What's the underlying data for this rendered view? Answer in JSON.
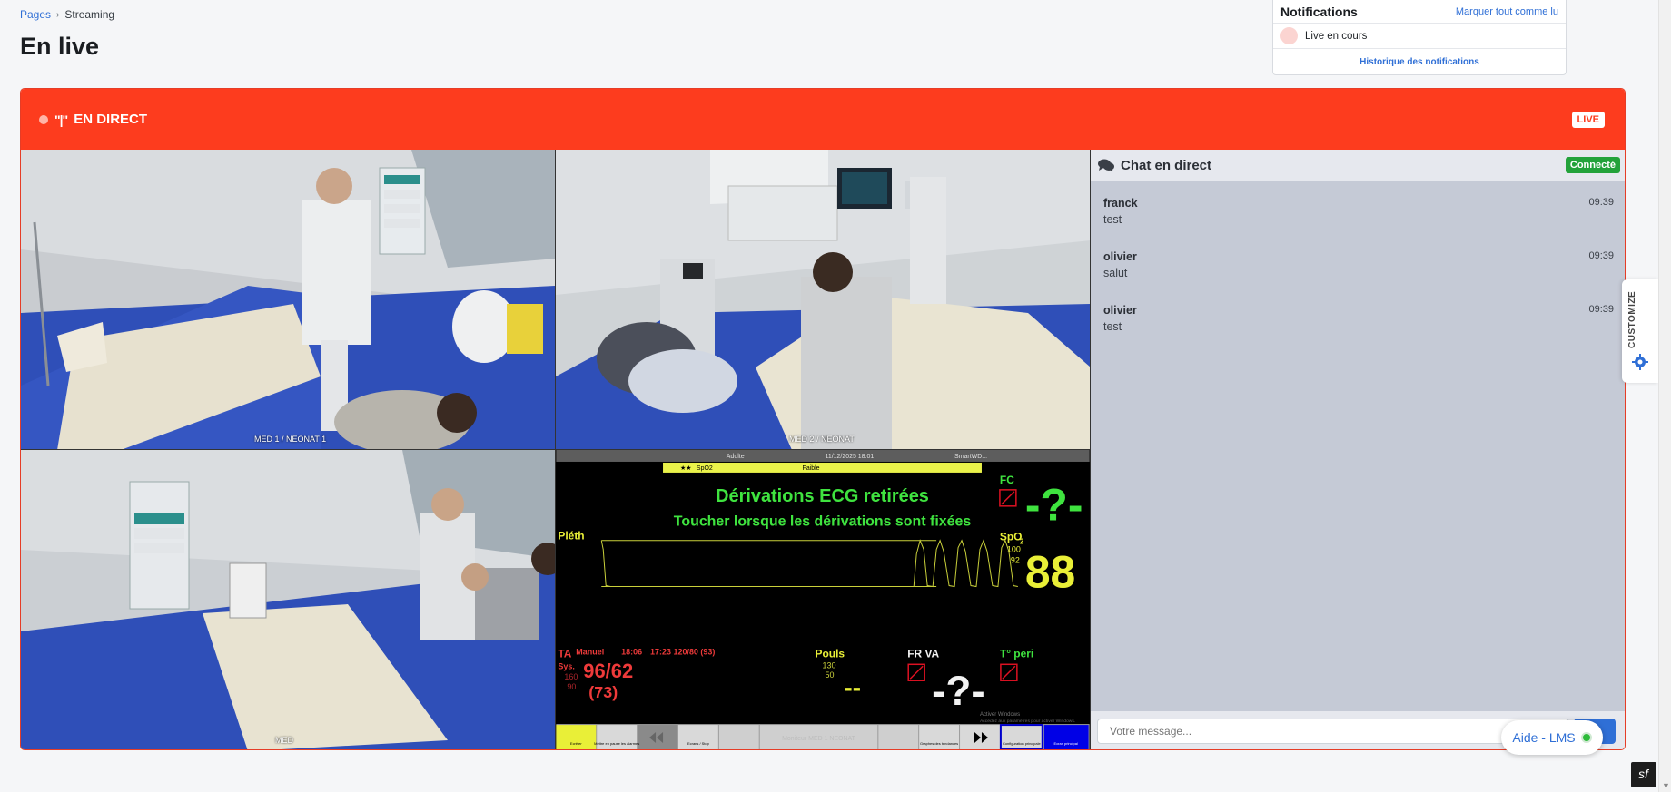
{
  "breadcrumb": {
    "parent": "Pages",
    "current": "Streaming"
  },
  "page": {
    "title": "En live"
  },
  "notifications": {
    "title": "Notifications",
    "mark_all": "Marquer tout comme lu",
    "items": [
      {
        "label": "Live en cours"
      }
    ],
    "history": "Historique des notifications"
  },
  "live": {
    "status_label": "EN DIRECT",
    "antenna": "\"|\"",
    "badge": "LIVE",
    "accent": "#fd3c1e"
  },
  "cameras": [
    {
      "label": "MED 1 / NEONAT 1"
    },
    {
      "label": "MED 2 / NEONAT"
    },
    {
      "label": "MED"
    }
  ],
  "monitor": {
    "top_bar": {
      "mode": "Adulte",
      "datetime": "11/12/2025 18:01",
      "unit": "SmartWD..."
    },
    "alarm_bar": {
      "stars": "★★",
      "param": "SpO2",
      "level": "Faible"
    },
    "ecg_msg": "Dérivations ECG retirées",
    "ecg_sub": "Toucher lorsque les dérivations sont fixées",
    "pleth_label": "Pléth",
    "fc_label": "FC",
    "fc_value": "-?-",
    "spo2_label": "SpO",
    "spo2_sub": "2",
    "spo2_high": "100",
    "spo2_low": "92",
    "spo2_value": "88",
    "ta_label": "TA",
    "ta_mode": "Manuel",
    "ta_time": "18:06",
    "ta_prev": "17:23 120/80 (93)",
    "ta_sys": "Sys.",
    "ta_high": "160",
    "ta_low": "90",
    "ta_value": "96/62",
    "ta_mean": "(73)",
    "pouls_label": "Pouls",
    "pouls_high": "130",
    "pouls_low": "50",
    "pouls_value": "--",
    "frva_label": "FR VA",
    "frva_value": "-?-",
    "temp_label": "T° peri",
    "watermark_1": "Activer Windows",
    "watermark_2": "Accédez aux paramètres pour activer Windows.",
    "bottom_center": "Moniteur MED 1 NEONAT",
    "buttons": [
      "Ecrêter",
      "Mettre en pause les alarmes",
      "",
      "Ecrans / Stop",
      "",
      "",
      "",
      "",
      "Graphes des tendances",
      "",
      "Configuration principale",
      "Ecran principal"
    ]
  },
  "chat": {
    "title": "Chat en direct",
    "status": "Connecté",
    "messages": [
      {
        "user": "franck",
        "time": "09:39",
        "text": "test"
      },
      {
        "user": "olivier",
        "time": "09:39",
        "text": "salut"
      },
      {
        "user": "olivier",
        "time": "09:39",
        "text": "test"
      }
    ],
    "input_placeholder": "Votre message..."
  },
  "customize": {
    "label": "CUSTOMIZE"
  },
  "help": {
    "label": "Aide - LMS",
    "status_color": "#2dbb3a"
  },
  "symfony": {
    "glyph": "sf"
  }
}
